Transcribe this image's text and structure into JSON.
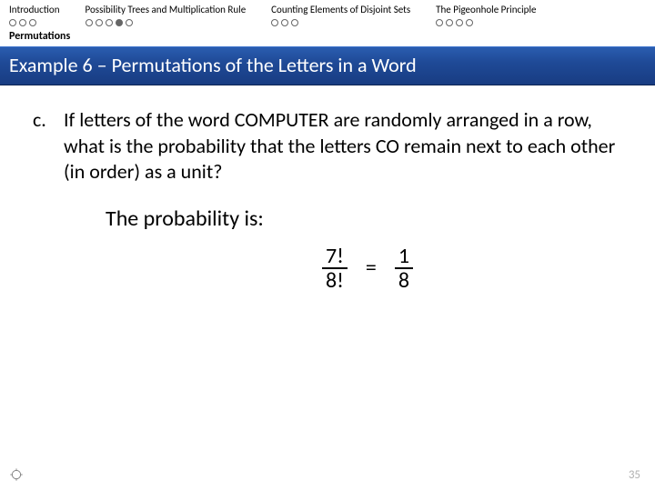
{
  "nav": {
    "items": [
      {
        "label": "Introduction",
        "dots": 3,
        "active": -1
      },
      {
        "label": "Possibility Trees and Multiplication Rule",
        "dots": 5,
        "active": 3
      },
      {
        "label": "Counting Elements of Disjoint Sets",
        "dots": 3,
        "active": -1
      },
      {
        "label": "The Pigeonhole Principle",
        "dots": 4,
        "active": -1
      }
    ]
  },
  "section_label": "Permutations",
  "title": "Example 6 – Permutations of the Letters in a Word",
  "item_marker": "c.",
  "item_text": "If letters of the word COMPUTER are randomly arranged in a row, what is the probability that the letters CO remain next to each other (in order) as a unit?",
  "probability_label": "The probability is:",
  "equation": {
    "lhs_num": "7!",
    "lhs_den": "8!",
    "eq": "=",
    "rhs_num": "1",
    "rhs_den": "8"
  },
  "page_number": "35"
}
